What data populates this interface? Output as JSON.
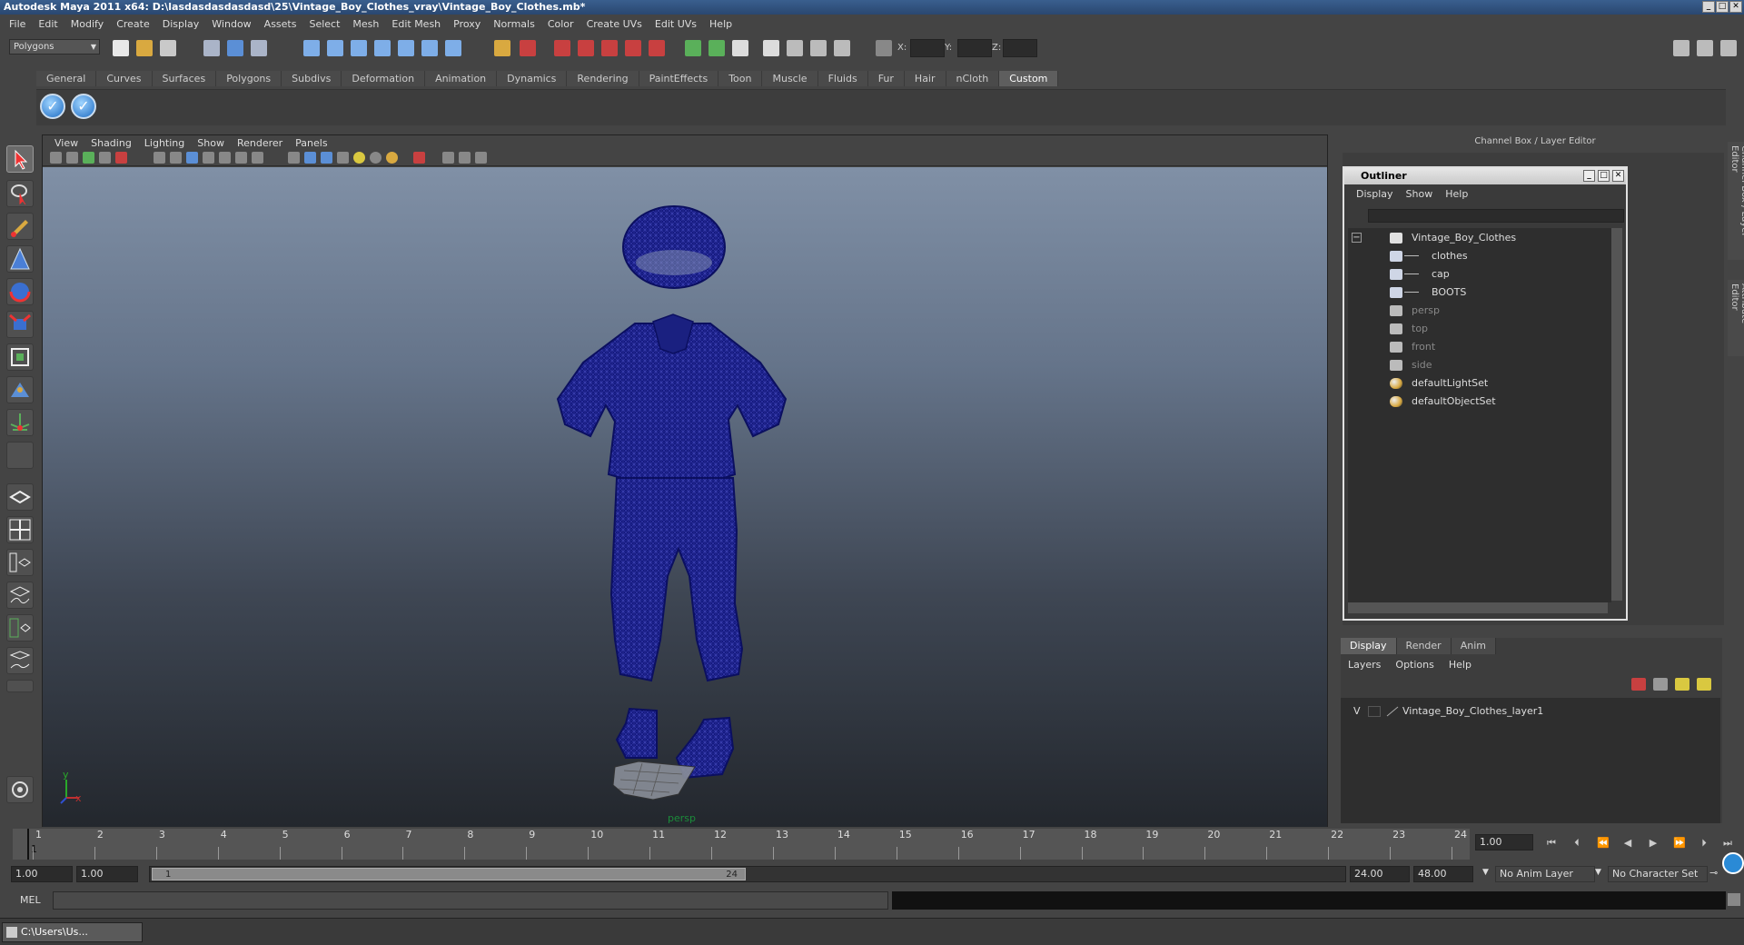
{
  "window": {
    "title": "Autodesk Maya 2011 x64: D:\\lasdasdasdasdasd\\25\\Vintage_Boy_Clothes_vray\\Vintage_Boy_Clothes.mb*",
    "controls": [
      "_",
      "□",
      "✕"
    ]
  },
  "menubar": [
    "File",
    "Edit",
    "Modify",
    "Create",
    "Display",
    "Window",
    "Assets",
    "Select",
    "Mesh",
    "Edit Mesh",
    "Proxy",
    "Normals",
    "Color",
    "Create UVs",
    "Edit UVs",
    "Help"
  ],
  "statusline": {
    "mode": "Polygons",
    "x_label": "X:",
    "y_label": "Y:",
    "z_label": "Z:"
  },
  "shelf": {
    "tabs": [
      "General",
      "Curves",
      "Surfaces",
      "Polygons",
      "Subdivs",
      "Deformation",
      "Animation",
      "Dynamics",
      "Rendering",
      "PaintEffects",
      "Toon",
      "Muscle",
      "Fluids",
      "Fur",
      "Hair",
      "nCloth",
      "Custom"
    ],
    "active": "Custom"
  },
  "viewport": {
    "menu": [
      "View",
      "Shading",
      "Lighting",
      "Show",
      "Renderer",
      "Panels"
    ],
    "camera": "persp",
    "axis_y": "y",
    "axis_x": "x"
  },
  "channelbox": {
    "title": "Channel Box / Layer Editor",
    "side_tab_1": "Channel Box / Layer Editor",
    "side_tab_2": "Attribute Editor"
  },
  "outliner": {
    "title": "Outliner",
    "menu": [
      "Display",
      "Show",
      "Help"
    ],
    "items": [
      {
        "label": "Vintage_Boy_Clothes",
        "icon": "transform-icon",
        "indent": 0,
        "dim": false,
        "expand": "−"
      },
      {
        "label": "clothes",
        "icon": "mesh-icon",
        "indent": 1,
        "dim": false
      },
      {
        "label": "cap",
        "icon": "mesh-icon",
        "indent": 1,
        "dim": false
      },
      {
        "label": "BOOTS",
        "icon": "mesh-icon",
        "indent": 1,
        "dim": false
      },
      {
        "label": "persp",
        "icon": "camera-icon",
        "indent": 0,
        "dim": true
      },
      {
        "label": "top",
        "icon": "camera-icon",
        "indent": 0,
        "dim": true
      },
      {
        "label": "front",
        "icon": "camera-icon",
        "indent": 0,
        "dim": true
      },
      {
        "label": "side",
        "icon": "camera-icon",
        "indent": 0,
        "dim": true
      },
      {
        "label": "defaultLightSet",
        "icon": "set-icon",
        "indent": 0,
        "dim": false
      },
      {
        "label": "defaultObjectSet",
        "icon": "set-icon",
        "indent": 0,
        "dim": false
      }
    ]
  },
  "layers": {
    "tabs": [
      "Display",
      "Render",
      "Anim"
    ],
    "active": "Display",
    "menu": [
      "Layers",
      "Options",
      "Help"
    ],
    "rows": [
      {
        "visible": "V",
        "name": "Vintage_Boy_Clothes_layer1"
      }
    ]
  },
  "timeline": {
    "ticks": [
      "1",
      "2",
      "3",
      "4",
      "5",
      "6",
      "7",
      "8",
      "9",
      "10",
      "11",
      "12",
      "13",
      "14",
      "15",
      "16",
      "17",
      "18",
      "19",
      "20",
      "21",
      "22",
      "23",
      "24"
    ],
    "current": "1",
    "current_field": "1.00"
  },
  "range": {
    "start": "1.00",
    "anim_start": "1.00",
    "slider_start": "1",
    "slider_end": "24",
    "end": "24.00",
    "anim_end": "48.00",
    "anim_layer": "No Anim Layer",
    "character_set": "No Character Set"
  },
  "cmd": {
    "label": "MEL"
  },
  "taskbar": {
    "label": "C:\\Users\\Us..."
  }
}
